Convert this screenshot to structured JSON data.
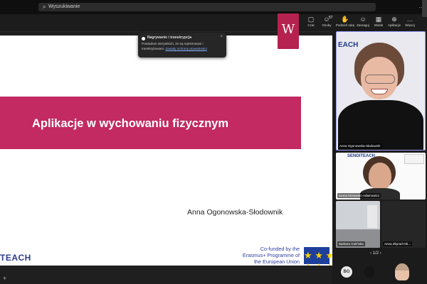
{
  "titlebar": {
    "search_placeholder": "Wyszukiwanie",
    "window_controls": "…"
  },
  "toolbar": {
    "buttons": [
      {
        "icon": "chat-icon",
        "glyph": "▢",
        "label": "Czat"
      },
      {
        "icon": "people-icon",
        "glyph": "☺",
        "label": "Osoby",
        "badge": "57"
      },
      {
        "icon": "raise-hand-icon",
        "glyph": "✋",
        "label": "Podnieś rękę"
      },
      {
        "icon": "react-icon",
        "glyph": "☺",
        "label": "Zareaguj"
      },
      {
        "icon": "view-icon",
        "glyph": "▦",
        "label": "Widok"
      },
      {
        "icon": "apps-icon",
        "glyph": "⊕",
        "label": "Aplikacje"
      },
      {
        "icon": "more-icon",
        "glyph": "…",
        "label": "Więcej"
      }
    ]
  },
  "notification": {
    "title": "Nagrywanie i transkrypcja",
    "body": "Powiadom wszystkich, że są rejestrowani i transkrybowani.",
    "link": "Zasady ochrony prywatności",
    "close": "×"
  },
  "slide": {
    "logo_text": "W",
    "title": "Aplikacje w wychowaniu fizycznym",
    "author": "Anna Ogonowska-Słodownik",
    "brand": "TEACH",
    "cofunded": "Co-funded by the Erasmus+ Programme of the European Union",
    "flag_stars": "★ ★ ★\n★ ★ ★"
  },
  "participants": [
    {
      "name": "Anna Ogonowska-Słodownik",
      "brand": "EACH"
    },
    {
      "name": "Iwona Morawiec-Adamowicz",
      "brand": "SENDITEACH"
    },
    {
      "name": "Barbara Golińska"
    },
    {
      "name": "Anna Zbyrad-Ob..."
    }
  ],
  "pager": "1/2",
  "avatars": [
    "BG"
  ],
  "colors": {
    "accent": "#c22a61",
    "slide_bg": "#ffffff",
    "brand_blue": "#2d3d8f"
  }
}
